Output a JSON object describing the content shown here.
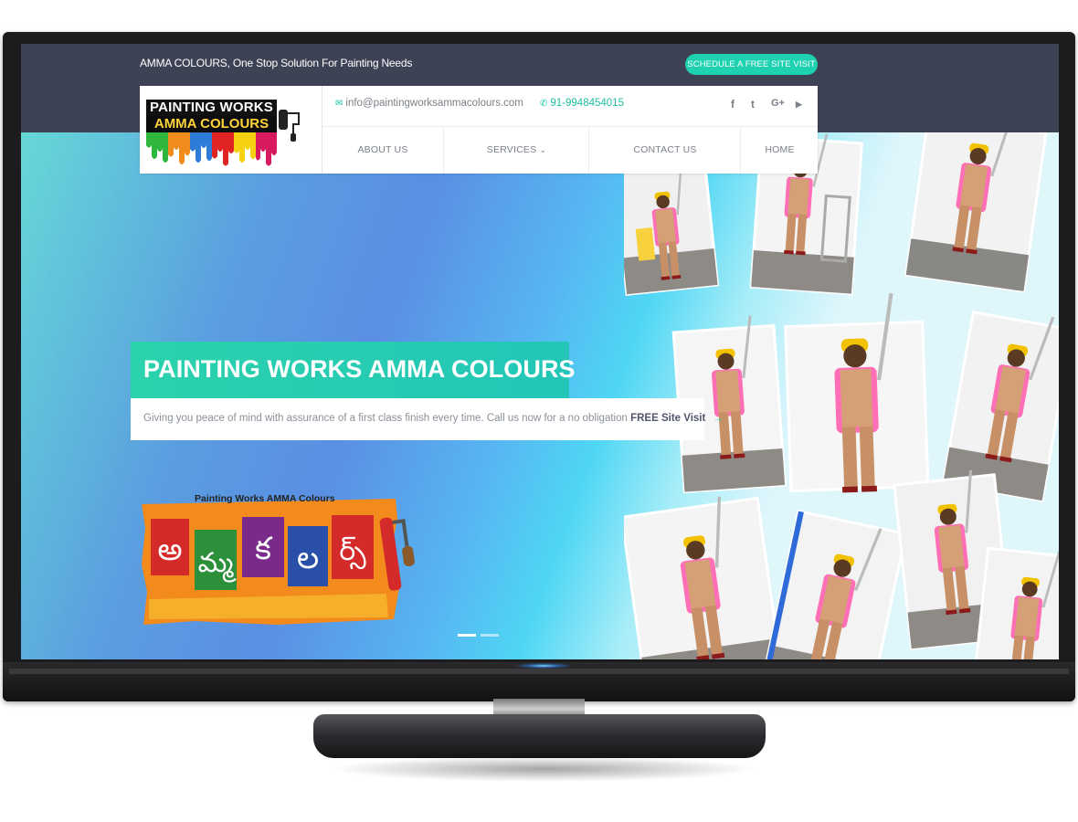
{
  "topbar": {
    "tagline": "AMMA COLOURS, One Stop Solution For Painting Needs",
    "schedule_button": "SCHEDULE A FREE SITE VISIT"
  },
  "logo": {
    "line1": "PAINTING WORKS",
    "line2": "AMMA COLOURS"
  },
  "contact": {
    "email_icon": "envelope-icon",
    "email": "info@paintingworksammacolours.com",
    "phone_icon": "phone-icon",
    "phone": "91-9948454015"
  },
  "social": {
    "facebook": "f",
    "twitter": "t",
    "google": "G+",
    "youtube": "▶"
  },
  "nav": {
    "about": "ABOUT US",
    "services": "SERVICES",
    "services_caret": "⌄",
    "contact": "CONTACT US",
    "home": "HOME"
  },
  "hero": {
    "title": "PAINTING WORKS AMMA COLOURS",
    "subtitle_prefix": "Giving you peace of mind with assurance of a first class finish every time. Call us now for a no obligation ",
    "subtitle_bold": "FREE Site Visit",
    "arrow": "→",
    "sign_caption": "Painting Works AMMA Colours",
    "sign_letters": [
      "అ",
      "మ్మ",
      "క",
      "ల",
      "ర్స్"
    ]
  },
  "slider": {
    "total": 2,
    "active": 1
  },
  "colors": {
    "accent": "#1ed1b0",
    "topbar": "#3d4254",
    "nav_text": "#7a8088"
  }
}
